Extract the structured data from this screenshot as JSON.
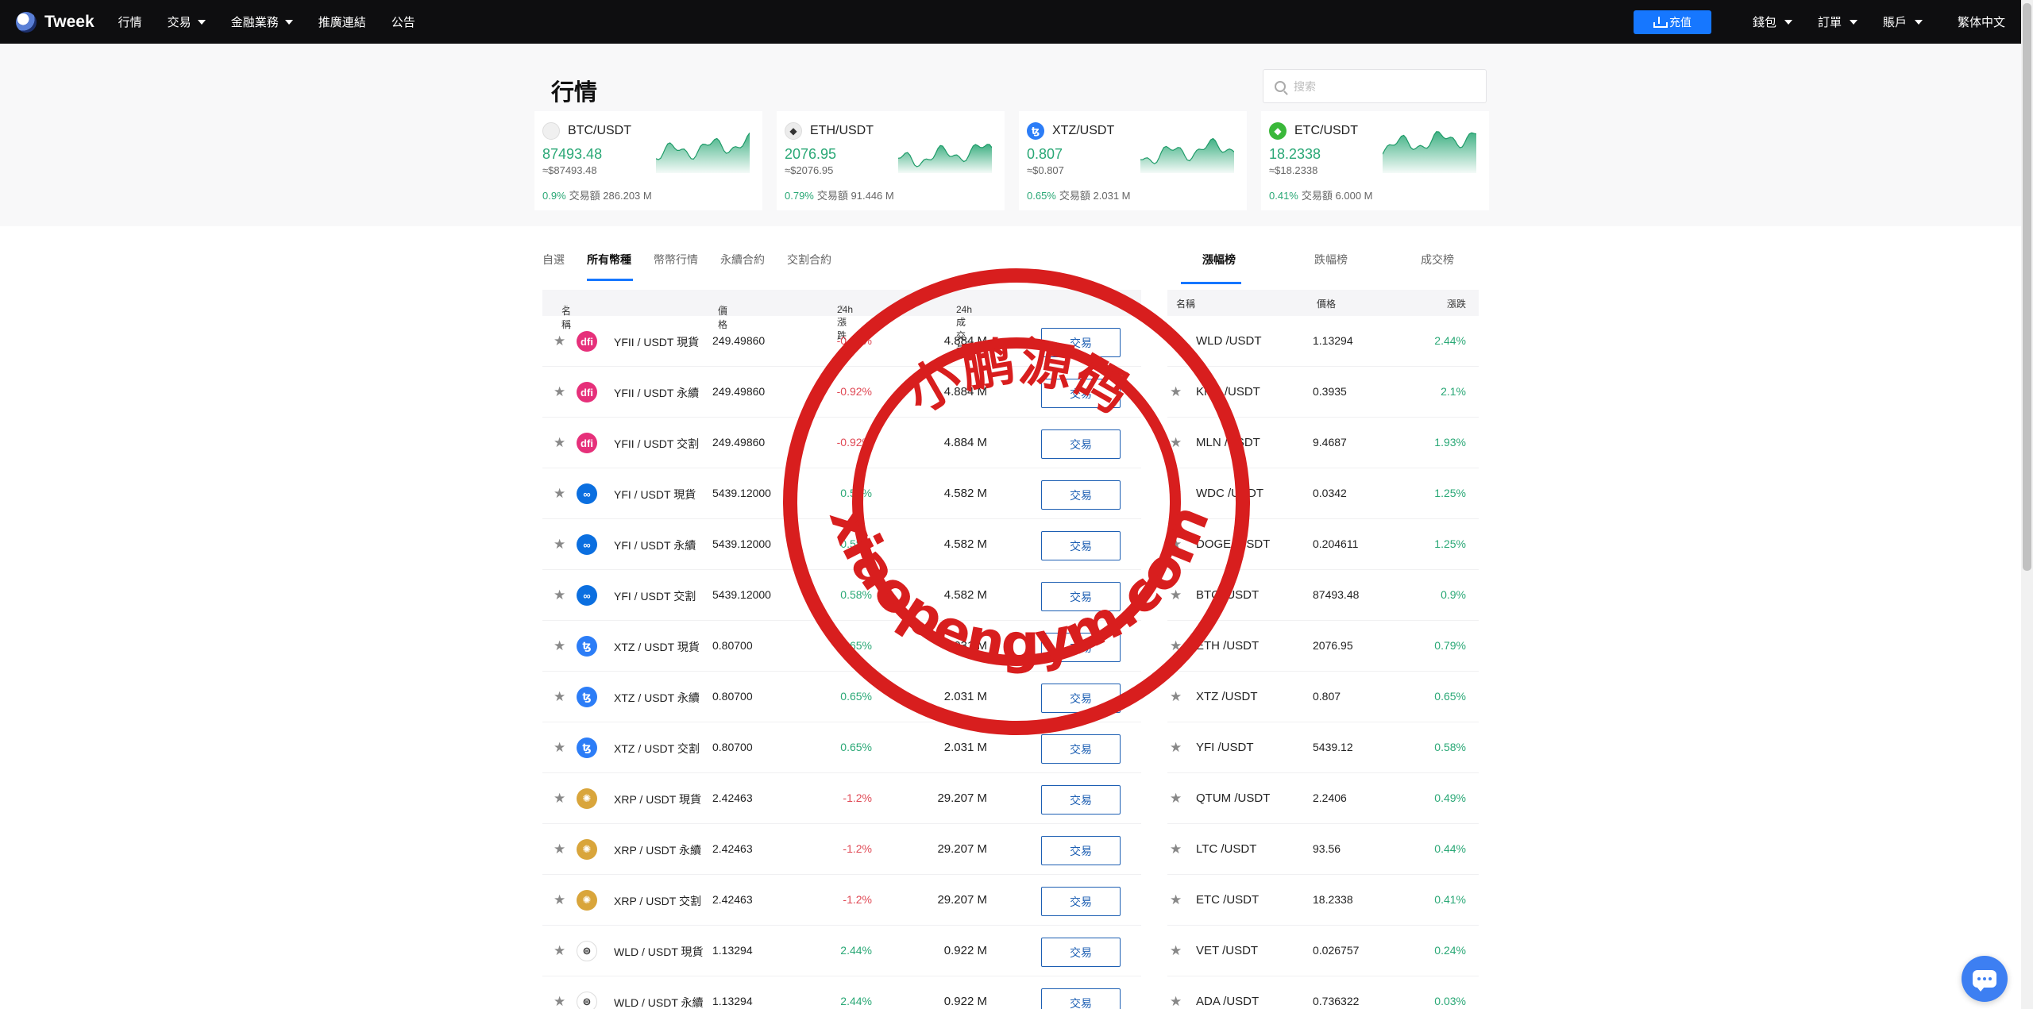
{
  "nav": {
    "brand": "Tweek",
    "items": [
      {
        "label": "行情",
        "dropdown": false
      },
      {
        "label": "交易",
        "dropdown": true
      },
      {
        "label": "金融業務",
        "dropdown": true
      },
      {
        "label": "推廣連結",
        "dropdown": false
      },
      {
        "label": "公告",
        "dropdown": false
      }
    ],
    "deposit_label": "充值",
    "right_items": [
      {
        "label": "錢包",
        "dropdown": true
      },
      {
        "label": "訂單",
        "dropdown": true
      },
      {
        "label": "賬戶",
        "dropdown": true
      }
    ],
    "language": "繁体中文"
  },
  "page": {
    "title": "行情",
    "search_placeholder": "搜索"
  },
  "cards": [
    {
      "pair": "BTC/USDT",
      "price": "87493.48",
      "fiat": "≈$87493.48",
      "change": "0.9%",
      "volume_label": "交易額",
      "volume": "286.203 M",
      "icon": "btc-icon",
      "color": "#f0f0f0",
      "glyph": ""
    },
    {
      "pair": "ETH/USDT",
      "price": "2076.95",
      "fiat": "≈$2076.95",
      "change": "0.79%",
      "volume_label": "交易額",
      "volume": "91.446 M",
      "icon": "eth-icon",
      "color": "#ececec",
      "glyph": "◆"
    },
    {
      "pair": "XTZ/USDT",
      "price": "0.807",
      "fiat": "≈$0.807",
      "change": "0.65%",
      "volume_label": "交易額",
      "volume": "2.031 M",
      "icon": "xtz-icon",
      "color": "#2c7df7",
      "glyph": "ꜩ"
    },
    {
      "pair": "ETC/USDT",
      "price": "18.2338",
      "fiat": "≈$18.2338",
      "change": "0.41%",
      "volume_label": "交易額",
      "volume": "6.000 M",
      "icon": "etc-icon",
      "color": "#3ab83a",
      "glyph": "◆"
    }
  ],
  "market": {
    "tabs": [
      "自選",
      "所有幣種",
      "幣幣行情",
      "永續合約",
      "交割合約"
    ],
    "active_tab": 1,
    "headers": {
      "name": "名稱",
      "price": "價格",
      "change": "24h漲跌",
      "volume": "24h成交量"
    },
    "trade_label": "交易",
    "rows": [
      {
        "name": "YFII / USDT 現貨",
        "price": "249.49860",
        "change": "-0.92%",
        "dir": "down",
        "volume": "4.884 M",
        "icon": "yfii-icon",
        "color": "#e6307a",
        "glyph": "dfi"
      },
      {
        "name": "YFII / USDT 永續",
        "price": "249.49860",
        "change": "-0.92%",
        "dir": "down",
        "volume": "4.884 M",
        "icon": "yfii-icon",
        "color": "#e6307a",
        "glyph": "dfi"
      },
      {
        "name": "YFII / USDT 交割",
        "price": "249.49860",
        "change": "-0.92%",
        "dir": "down",
        "volume": "4.884 M",
        "icon": "yfii-icon",
        "color": "#e6307a",
        "glyph": "dfi"
      },
      {
        "name": "YFI / USDT 現貨",
        "price": "5439.12000",
        "change": "0.58%",
        "dir": "up",
        "volume": "4.582 M",
        "icon": "yfi-icon",
        "color": "#0b6fe0",
        "glyph": "∞"
      },
      {
        "name": "YFI / USDT 永續",
        "price": "5439.12000",
        "change": "0.58%",
        "dir": "up",
        "volume": "4.582 M",
        "icon": "yfi-icon",
        "color": "#0b6fe0",
        "glyph": "∞"
      },
      {
        "name": "YFI / USDT 交割",
        "price": "5439.12000",
        "change": "0.58%",
        "dir": "up",
        "volume": "4.582 M",
        "icon": "yfi-icon",
        "color": "#0b6fe0",
        "glyph": "∞"
      },
      {
        "name": "XTZ / USDT 現貨",
        "price": "0.80700",
        "change": "0.65%",
        "dir": "up",
        "volume": "2.031 M",
        "icon": "xtz-icon",
        "color": "#2c7df7",
        "glyph": "ꜩ"
      },
      {
        "name": "XTZ / USDT 永續",
        "price": "0.80700",
        "change": "0.65%",
        "dir": "up",
        "volume": "2.031 M",
        "icon": "xtz-icon",
        "color": "#2c7df7",
        "glyph": "ꜩ"
      },
      {
        "name": "XTZ / USDT 交割",
        "price": "0.80700",
        "change": "0.65%",
        "dir": "up",
        "volume": "2.031 M",
        "icon": "xtz-icon",
        "color": "#2c7df7",
        "glyph": "ꜩ"
      },
      {
        "name": "XRP / USDT 現貨",
        "price": "2.42463",
        "change": "-1.2%",
        "dir": "down",
        "volume": "29.207 M",
        "icon": "xrp-icon",
        "color": "#d9a53b",
        "glyph": "✺"
      },
      {
        "name": "XRP / USDT 永續",
        "price": "2.42463",
        "change": "-1.2%",
        "dir": "down",
        "volume": "29.207 M",
        "icon": "xrp-icon",
        "color": "#d9a53b",
        "glyph": "✺"
      },
      {
        "name": "XRP / USDT 交割",
        "price": "2.42463",
        "change": "-1.2%",
        "dir": "down",
        "volume": "29.207 M",
        "icon": "xrp-icon",
        "color": "#d9a53b",
        "glyph": "✺"
      },
      {
        "name": "WLD / USDT 現貨",
        "price": "1.13294",
        "change": "2.44%",
        "dir": "up",
        "volume": "0.922 M",
        "icon": "wld-icon",
        "color": "#ffffff",
        "glyph": "⊜"
      },
      {
        "name": "WLD / USDT 永續",
        "price": "1.13294",
        "change": "2.44%",
        "dir": "up",
        "volume": "0.922 M",
        "icon": "wld-icon",
        "color": "#ffffff",
        "glyph": "⊜"
      }
    ]
  },
  "ranking": {
    "tabs": [
      "漲幅榜",
      "跌幅榜",
      "成交榜"
    ],
    "active_tab": 0,
    "headers": {
      "name": "名稱",
      "price": "價格",
      "change": "漲跌"
    },
    "rows": [
      {
        "name": "WLD /USDT",
        "price": "1.13294",
        "change": "2.44%"
      },
      {
        "name": "KNC /USDT",
        "price": "0.3935",
        "change": "2.1%"
      },
      {
        "name": "MLN /USDT",
        "price": "9.4687",
        "change": "1.93%"
      },
      {
        "name": "WDC /USDT",
        "price": "0.0342",
        "change": "1.25%"
      },
      {
        "name": "DOGE /USDT",
        "price": "0.204611",
        "change": "1.25%"
      },
      {
        "name": "BTC /USDT",
        "price": "87493.48",
        "change": "0.9%"
      },
      {
        "name": "ETH /USDT",
        "price": "2076.95",
        "change": "0.79%"
      },
      {
        "name": "XTZ /USDT",
        "price": "0.807",
        "change": "0.65%"
      },
      {
        "name": "YFI /USDT",
        "price": "5439.12",
        "change": "0.58%"
      },
      {
        "name": "QTUM /USDT",
        "price": "2.2406",
        "change": "0.49%"
      },
      {
        "name": "LTC /USDT",
        "price": "93.56",
        "change": "0.44%"
      },
      {
        "name": "ETC /USDT",
        "price": "18.2338",
        "change": "0.41%"
      },
      {
        "name": "VET /USDT",
        "price": "0.026757",
        "change": "0.24%"
      },
      {
        "name": "ADA /USDT",
        "price": "0.736322",
        "change": "0.03%"
      }
    ]
  },
  "watermark": {
    "top_text": "小鹏源码",
    "bottom_text": "xiaopengym.com",
    "color": "#d81e1e"
  },
  "colors": {
    "up": "#2aa876",
    "down": "#e04955",
    "accent": "#1677ff"
  }
}
